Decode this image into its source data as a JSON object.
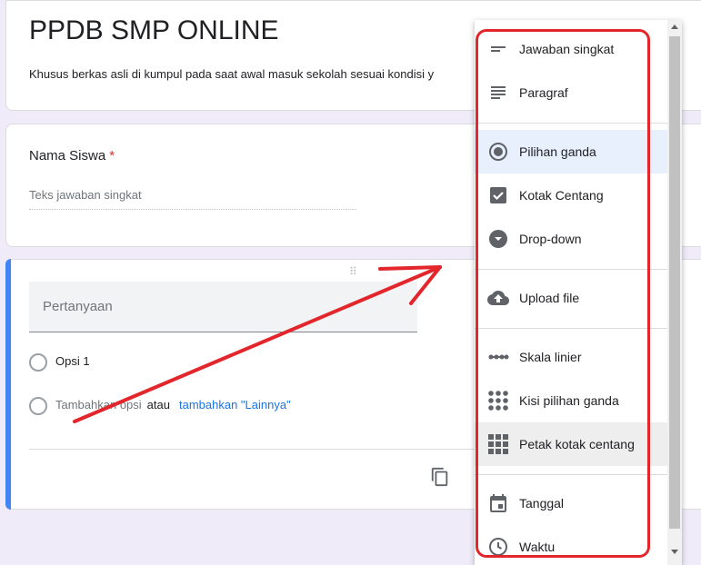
{
  "form": {
    "title": "PPDB SMP ONLINE",
    "description": "Khusus berkas asli di kumpul pada saat awal masuk sekolah sesuai kondisi y",
    "questions": [
      {
        "label": "Nama Siswa",
        "required_mark": "*",
        "answer_placeholder": "Teks jawaban singkat"
      }
    ]
  },
  "editor": {
    "question_placeholder": "Pertanyaan",
    "option_1": "Opsi 1",
    "add_option": "Tambahkan opsi",
    "or_text": "atau",
    "add_other": "tambahkan \"Lainnya\"",
    "drag_handle": "⠿"
  },
  "type_menu": {
    "items": [
      {
        "label": "Jawaban singkat",
        "icon": "short-answer-icon"
      },
      {
        "label": "Paragraf",
        "icon": "paragraph-icon"
      },
      {
        "label": "Pilihan ganda",
        "icon": "radio-icon",
        "state": "selected"
      },
      {
        "label": "Kotak Centang",
        "icon": "checkbox-icon"
      },
      {
        "label": "Drop-down",
        "icon": "dropdown-icon"
      },
      {
        "label": "Upload file",
        "icon": "upload-cloud-icon"
      },
      {
        "label": "Skala linier",
        "icon": "linear-scale-icon"
      },
      {
        "label": "Kisi pilihan ganda",
        "icon": "grid-dots-icon"
      },
      {
        "label": "Petak kotak centang",
        "icon": "grid-squares-icon",
        "state": "hovered"
      },
      {
        "label": "Tanggal",
        "icon": "calendar-icon"
      },
      {
        "label": "Waktu",
        "icon": "clock-icon"
      }
    ]
  },
  "colors": {
    "background": "#f0ebf8",
    "accent_blue": "#4285f4",
    "link_blue": "#1a73e8",
    "annotation_red": "#e3262b"
  }
}
